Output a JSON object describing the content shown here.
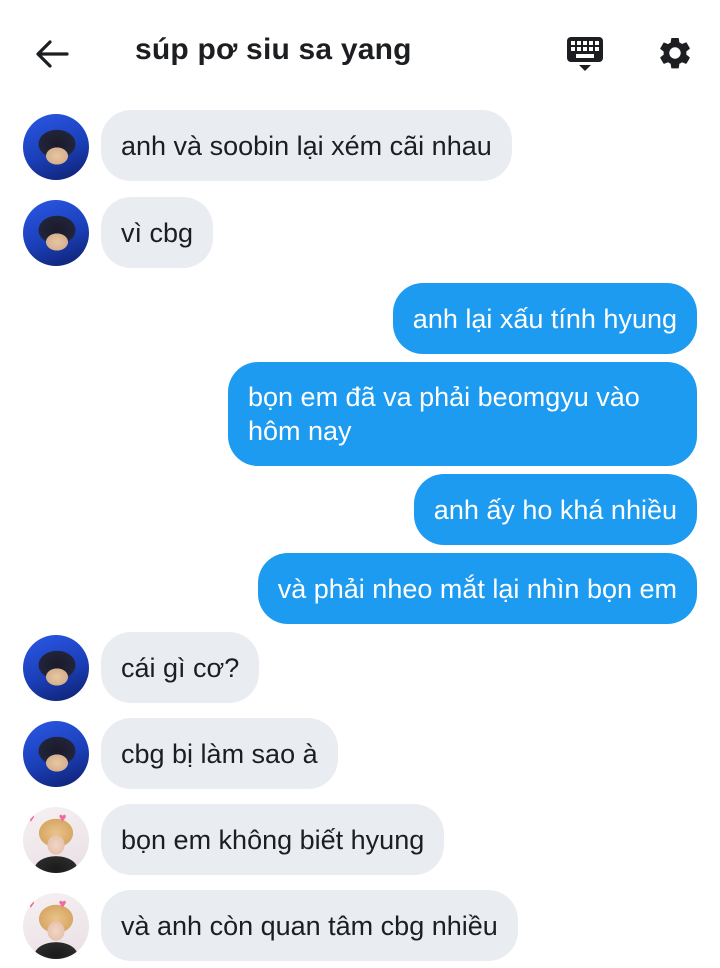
{
  "header": {
    "title": "súp pơ siu sa yang",
    "back_icon": "arrow-left-icon",
    "keyboard_icon": "keyboard-icon",
    "settings_icon": "gear-icon"
  },
  "colors": {
    "incoming_bubble": "#e9ecf0",
    "outgoing_bubble": "#1d9bf0",
    "outgoing_text": "#ffffff",
    "text": "#1c1e21"
  },
  "messages": [
    {
      "direction": "in",
      "avatar": "avatar-a",
      "text": "anh và soobin lại xém cãi nhau"
    },
    {
      "direction": "in",
      "avatar": "avatar-a",
      "text": "vì cbg"
    },
    {
      "direction": "out",
      "text": "anh lại xấu tính hyung"
    },
    {
      "direction": "out",
      "text": "bọn em đã va phải beomgyu vào hôm nay"
    },
    {
      "direction": "out",
      "text": "anh ấy ho khá nhiều"
    },
    {
      "direction": "out",
      "text": "và phải nheo mắt lại nhìn bọn em"
    },
    {
      "direction": "in",
      "avatar": "avatar-a",
      "text": "cái gì cơ?"
    },
    {
      "direction": "in",
      "avatar": "avatar-a",
      "text": "cbg bị làm sao à"
    },
    {
      "direction": "in",
      "avatar": "avatar-b",
      "text": "bọn em không biết hyung"
    },
    {
      "direction": "in",
      "avatar": "avatar-b",
      "text": "và anh còn quan tâm cbg nhiều"
    }
  ]
}
